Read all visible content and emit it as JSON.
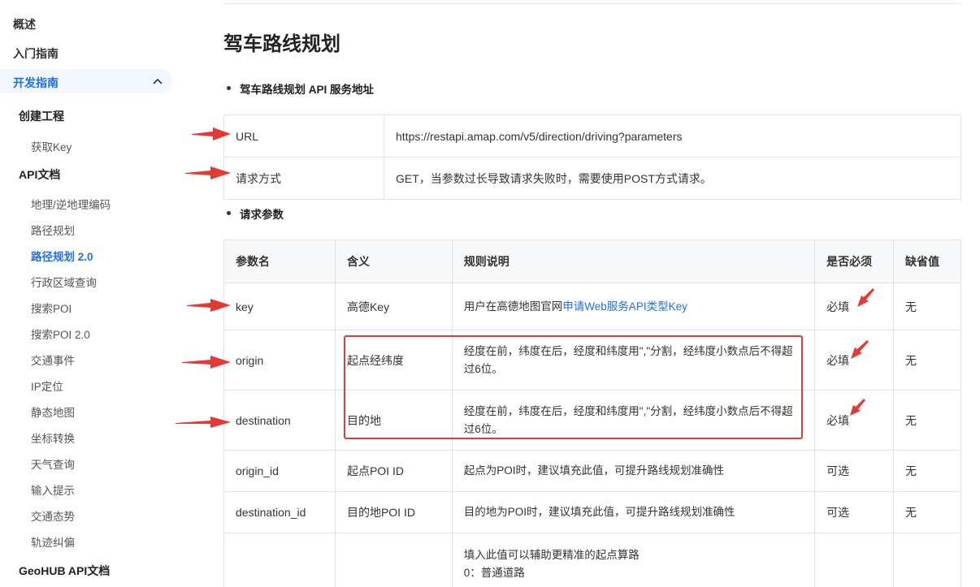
{
  "sidebar": {
    "top_items": [
      "概述",
      "入门指南"
    ],
    "active_group": "开发指南",
    "sections": {
      "create_project": "创建工程",
      "get_key": "获取Key",
      "api_docs": "API文档",
      "api_items": [
        "地理/逆地理编码",
        "路径规划",
        "路径规划 2.0",
        "行政区域查询",
        "搜索POI",
        "搜索POI 2.0",
        "交通事件",
        "IP定位",
        "静态地图",
        "坐标转换",
        "天气查询",
        "输入提示",
        "交通态势",
        "轨迹纠偏"
      ],
      "active_item_index": 2,
      "geohub": "GeoHUB API文档"
    }
  },
  "main": {
    "title": "驾车路线规划",
    "bullet1": "驾车路线规划 API 服务地址",
    "service_table": [
      {
        "label": "URL",
        "value": "https://restapi.amap.com/v5/direction/driving?parameters"
      },
      {
        "label": "请求方式",
        "value": "GET，当参数过长导致请求失败时，需要使用POST方式请求。"
      }
    ],
    "bullet2": "请求参数",
    "params_headers": [
      "参数名",
      "含义",
      "规则说明",
      "是否必须",
      "缺省值"
    ],
    "params_rows": [
      {
        "name": "key",
        "meaning": "高德Key",
        "rule_prefix": "用户在高德地图官网",
        "rule_link": "申请Web服务API类型Key",
        "required": "必填",
        "default": "无"
      },
      {
        "name": "origin",
        "meaning": "起点经纬度",
        "rule_prefix": "经度在前，纬度在后，经度和纬度用\",\"分割，经纬度小数点后不得超过6位。",
        "rule_link": "",
        "required": "必填",
        "default": "无"
      },
      {
        "name": "destination",
        "meaning": "目的地",
        "rule_prefix": "经度在前，纬度在后，经度和纬度用\",\"分割，经纬度小数点后不得超过6位。",
        "rule_link": "",
        "required": "必填",
        "default": "无"
      },
      {
        "name": "origin_id",
        "meaning": "起点POI ID",
        "rule_prefix": "起点为POI时，建议填充此值，可提升路线规划准确性",
        "rule_link": "",
        "required": "可选",
        "default": "无"
      },
      {
        "name": "destination_id",
        "meaning": "目的地POI ID",
        "rule_prefix": "目的地为POI时，建议填充此值，可提升路线规划准确性",
        "rule_link": "",
        "required": "可选",
        "default": "无"
      }
    ],
    "partial_row_lines": [
      "填入此值可以辅助更精准的起点算路",
      "0：普通道路"
    ]
  },
  "colors": {
    "accent": "#1f6fe5",
    "annotation": "#e53935"
  }
}
